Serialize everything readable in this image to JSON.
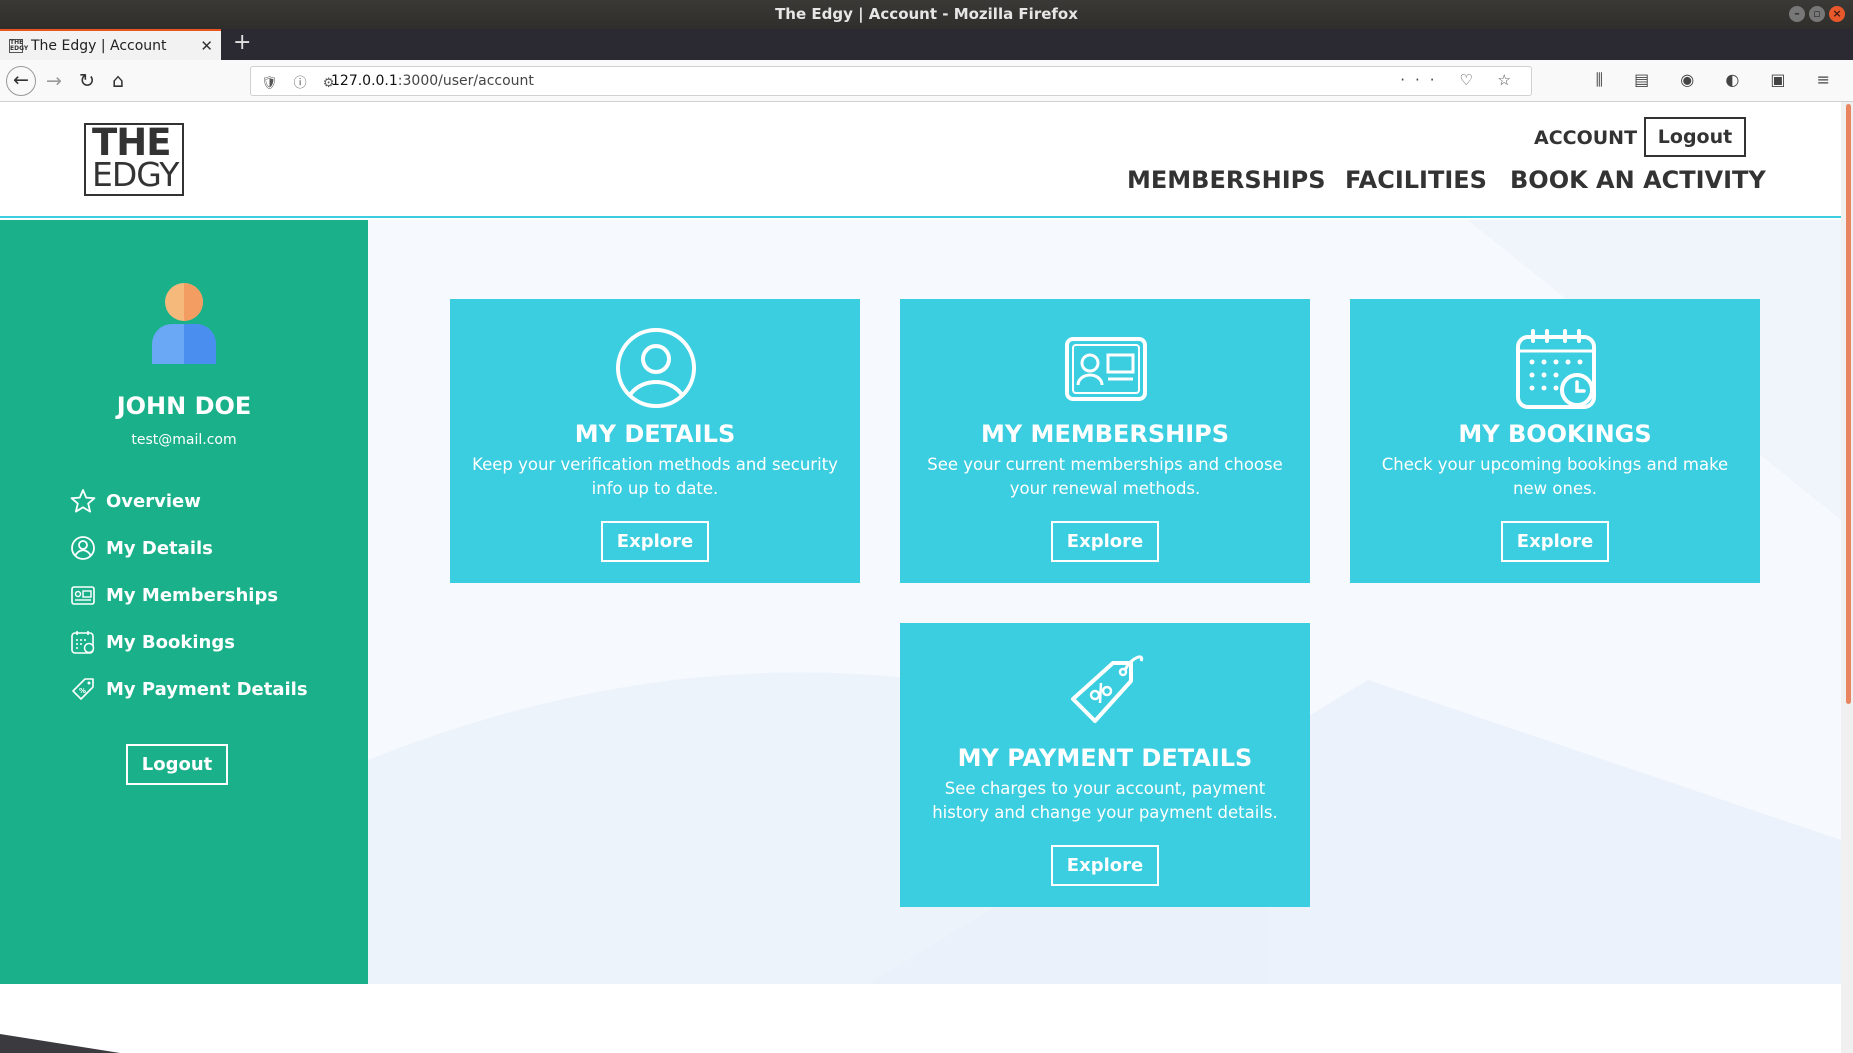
{
  "window": {
    "title": "The Edgy | Account - Mozilla Firefox"
  },
  "browser": {
    "tab_title": "The Edgy | Account",
    "url_host": "127.0.0.1",
    "url_rest": ":3000/user/account"
  },
  "header": {
    "logo_line1": "THE",
    "logo_line2": "EDGY",
    "account_link": "ACCOUNT",
    "logout_button": "Logout",
    "nav": [
      "MEMBERSHIPS",
      "FACILITIES",
      "BOOK AN ACTIVITY"
    ]
  },
  "sidebar": {
    "user_name": "JOHN DOE",
    "user_email": "test@mail.com",
    "items": [
      {
        "label": "Overview",
        "icon": "star-icon"
      },
      {
        "label": "My Details",
        "icon": "user-circle-icon"
      },
      {
        "label": "My Memberships",
        "icon": "id-card-icon"
      },
      {
        "label": "My Bookings",
        "icon": "calendar-icon"
      },
      {
        "label": "My Payment Details",
        "icon": "price-tag-icon"
      }
    ],
    "logout_button": "Logout"
  },
  "cards": [
    {
      "title": "MY DETAILS",
      "description": "Keep your verification methods and security info up to date.",
      "button": "Explore",
      "icon": "user-circle-icon"
    },
    {
      "title": "MY MEMBERSHIPS",
      "description": "See your current memberships and choose your renewal methods.",
      "button": "Explore",
      "icon": "id-card-icon"
    },
    {
      "title": "MY BOOKINGS",
      "description": "Check your upcoming bookings and make new ones.",
      "button": "Explore",
      "icon": "calendar-icon"
    },
    {
      "title": "MY PAYMENT DETAILS",
      "description": "See charges to your account, payment history and change your payment details.",
      "button": "Explore",
      "icon": "price-tag-icon"
    }
  ],
  "colors": {
    "sidebar": "#19b08a",
    "card": "#3bcde0",
    "header_border": "#3bcde0",
    "text_dark": "#333333"
  }
}
